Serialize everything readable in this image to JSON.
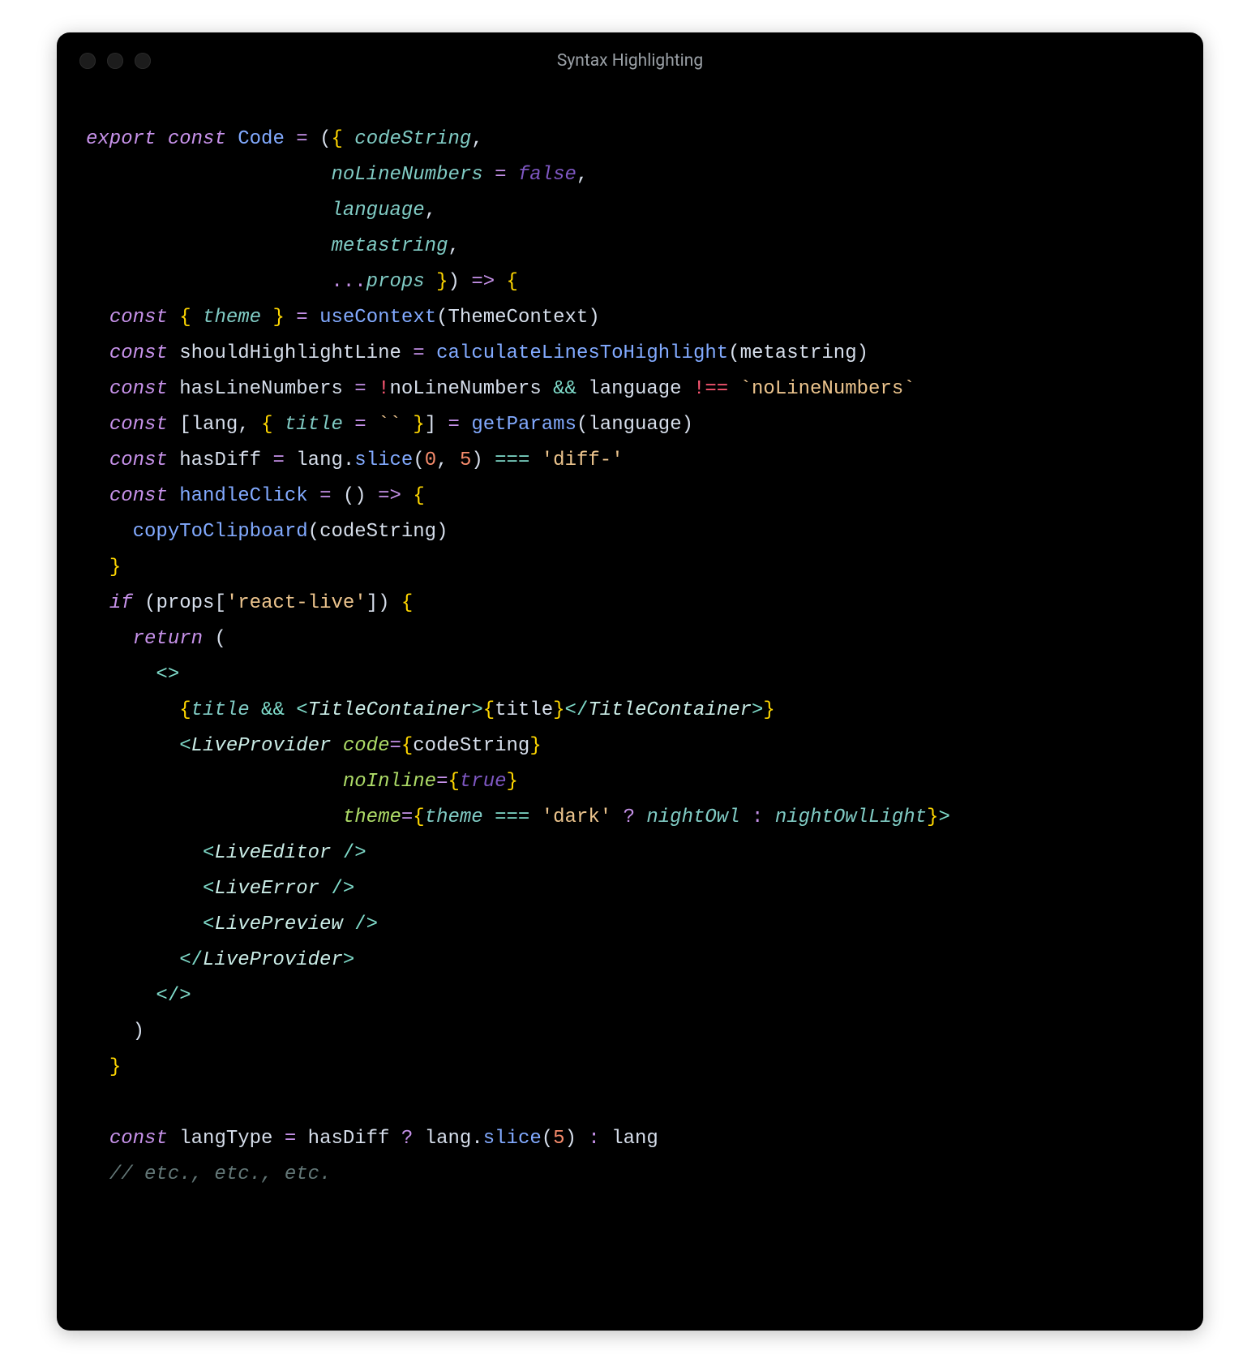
{
  "window": {
    "title": "Syntax Highlighting"
  },
  "code": {
    "t": {
      "export": "export",
      "const": "const",
      "Code": "Code",
      "eq": "=",
      "lpar": "(",
      "rpar": ")",
      "lcur": "{",
      "rcur": "}",
      "lbr": "[",
      "rbr": "]",
      "comma": ",",
      "dot": ".",
      "arrow": "=>",
      "spread": "...",
      "bang": "!",
      "andand": "&&",
      "neq": "!==",
      "eqeqeq": "===",
      "qmark": "?",
      "colon": ":",
      "lt": "<",
      "gt": ">",
      "ltc": "</",
      "selfclose": "/>",
      "fragOpen": "<>",
      "fragClose": "</>",
      "codeString": "codeString",
      "noLineNumbers": "noLineNumbers",
      "language": "language",
      "metastring": "metastring",
      "props": "props",
      "theme": "theme",
      "useContext": "useContext",
      "ThemeContext": "ThemeContext",
      "shouldHighlightLine": "shouldHighlightLine",
      "calculateLinesToHighlight": "calculateLinesToHighlight",
      "hasLineNumbers": "hasLineNumbers",
      "btNoLineNumbers": "`noLineNumbers`",
      "lang": "lang",
      "title": "title",
      "btEmpty": "``",
      "getParams": "getParams",
      "hasDiff": "hasDiff",
      "slice": "slice",
      "n0": "0",
      "n5": "5",
      "sDiff": "'diff-'",
      "handleClick": "handleClick",
      "copyToClipboard": "copyToClipboard",
      "if": "if",
      "sReactLive": "'react-live'",
      "return": "return",
      "TitleContainer": "TitleContainer",
      "LiveProvider": "LiveProvider",
      "aCode": "code",
      "aNoInline": "noInline",
      "aTheme": "theme",
      "sDark": "'dark'",
      "nightOwl": "nightOwl",
      "nightOwlLight": "nightOwlLight",
      "LiveEditor": "LiveEditor",
      "LiveError": "LiveError",
      "LivePreview": "LivePreview",
      "langType": "langType",
      "comment": "// etc., etc., etc.",
      "false": "false",
      "true": "true"
    }
  }
}
